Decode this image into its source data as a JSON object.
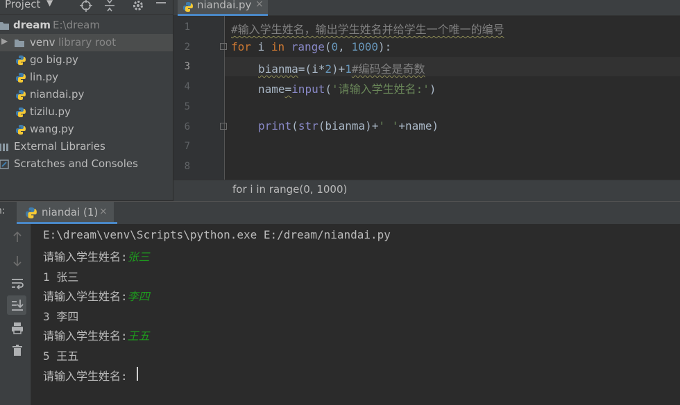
{
  "project_panel": {
    "title": "Project",
    "tree": [
      {
        "label": "dream",
        "sub": "E:\\dream",
        "kind": "root-folder"
      },
      {
        "label": "venv",
        "sub": "library root",
        "kind": "folder"
      },
      {
        "label": "go big.py",
        "kind": "py"
      },
      {
        "label": "lin.py",
        "kind": "py"
      },
      {
        "label": "niandai.py",
        "kind": "py"
      },
      {
        "label": "tizilu.py",
        "kind": "py"
      },
      {
        "label": "wang.py",
        "kind": "py"
      },
      {
        "label": "External Libraries",
        "kind": "libs"
      },
      {
        "label": "Scratches and Consoles",
        "kind": "scratch"
      }
    ]
  },
  "editor": {
    "tab_label": "niandai.py",
    "tab_close": "×",
    "line_numbers": [
      "1",
      "2",
      "3",
      "4",
      "5",
      "6",
      "7",
      "8"
    ],
    "code": {
      "l1": "#输入学生姓名，输出学生姓名并给学生一个唯一的编号",
      "l2_kw_for": "for",
      "l2_var": " i ",
      "l2_kw_in": "in",
      "l2_sp": " ",
      "l2_range": "range",
      "l2_p1": "(",
      "l2_n0": "0",
      "l2_comma": ", ",
      "l2_n1000": "1000",
      "l2_end": "):",
      "l3_var": "bianma",
      "l3_eq": "=(i*",
      "l3_n2": "2",
      "l3_plus": ")+",
      "l3_n1": "1",
      "l3_cmt": "#编码全是奇数",
      "l4_var": "name",
      "l4_eq": "=",
      "l4_input": "input",
      "l4_p": "(",
      "l4_str": "'请输入学生姓名:'",
      "l4_end": ")",
      "l6_print": "print",
      "l6_p": "(",
      "l6_str": "str",
      "l6_mid": "(bianma)+",
      "l6_sp": "' '",
      "l6_end": "+name)"
    },
    "breadcrumb": "for i in range(0, 1000)"
  },
  "run_panel": {
    "label": "n:",
    "tab_label": "niandai (1)",
    "tab_close": "×",
    "console": {
      "cmd": "E:\\dream\\venv\\Scripts\\python.exe E:/dream/niandai.py",
      "prompt": "请输入学生姓名:",
      "input_1": "张三",
      "out_1": "1 张三",
      "input_2": "李四",
      "out_2": "3 李四",
      "input_3": "王五",
      "out_3": "5 王五"
    }
  }
}
